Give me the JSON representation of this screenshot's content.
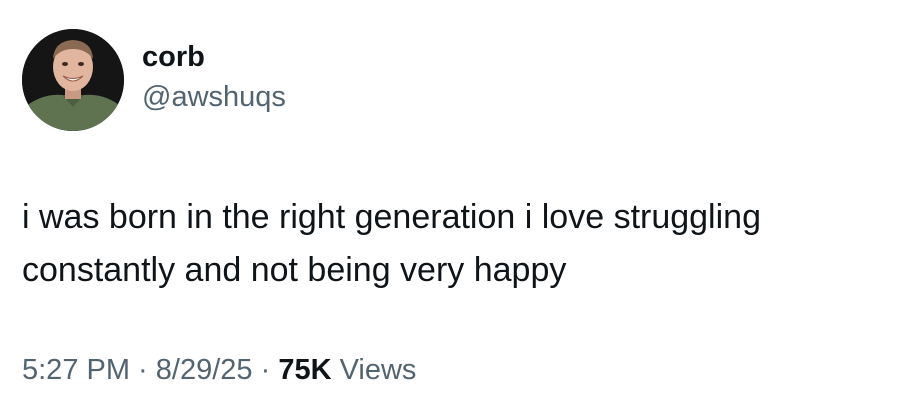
{
  "author": {
    "display_name": "corb",
    "handle": "@awshuqs",
    "avatar_icon": "profile-photo-avatar"
  },
  "post": {
    "text": "i was born in the right generation i love struggling constantly and not being very happy"
  },
  "meta": {
    "time": "5:27 PM",
    "separator1": " · ",
    "date": "8/29/25",
    "separator2": " · ",
    "views_count": "75K",
    "views_label": " Views"
  },
  "colors": {
    "primary_text": "#0f1419",
    "secondary_text": "#536471",
    "background": "#ffffff"
  }
}
